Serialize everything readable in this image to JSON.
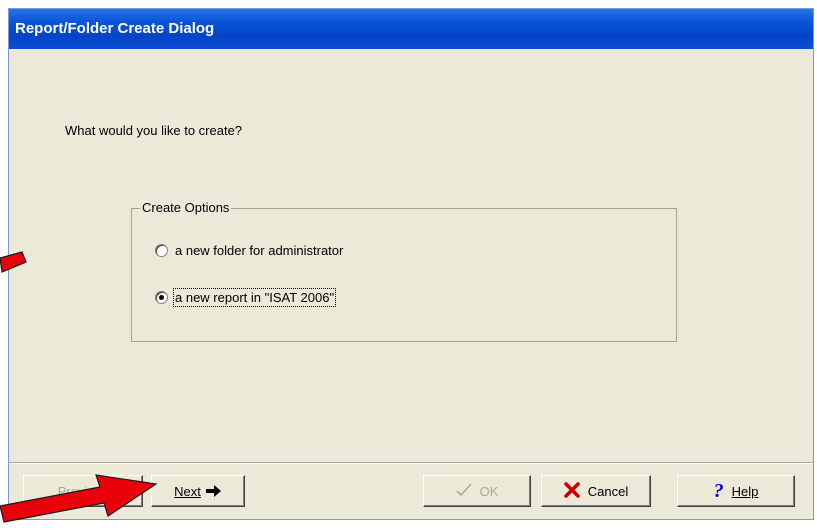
{
  "window": {
    "title": "Report/Folder Create Dialog"
  },
  "prompt": "What would you like to create?",
  "create_options": {
    "title": "Create Options",
    "options": [
      {
        "label": "a new folder for administrator",
        "checked": false
      },
      {
        "label": "a new report in \"ISAT 2006\"",
        "checked": true
      }
    ]
  },
  "buttons": {
    "previous": {
      "label": "Previous",
      "enabled": false
    },
    "next": {
      "label": "Next",
      "icon": "right-arrow-icon"
    },
    "ok": {
      "label": "OK",
      "icon": "check-icon",
      "enabled": false
    },
    "cancel": {
      "label": "Cancel",
      "icon": "red-x-icon"
    },
    "help": {
      "label": "Help",
      "icon": "question-mark-icon"
    }
  },
  "colors": {
    "title_bar": "#0a56d8",
    "dialog_bg": "#ece9d8",
    "annotation_arrow": "#e8000b",
    "cancel_icon": "#cc0000",
    "help_icon": "#0000cc"
  }
}
